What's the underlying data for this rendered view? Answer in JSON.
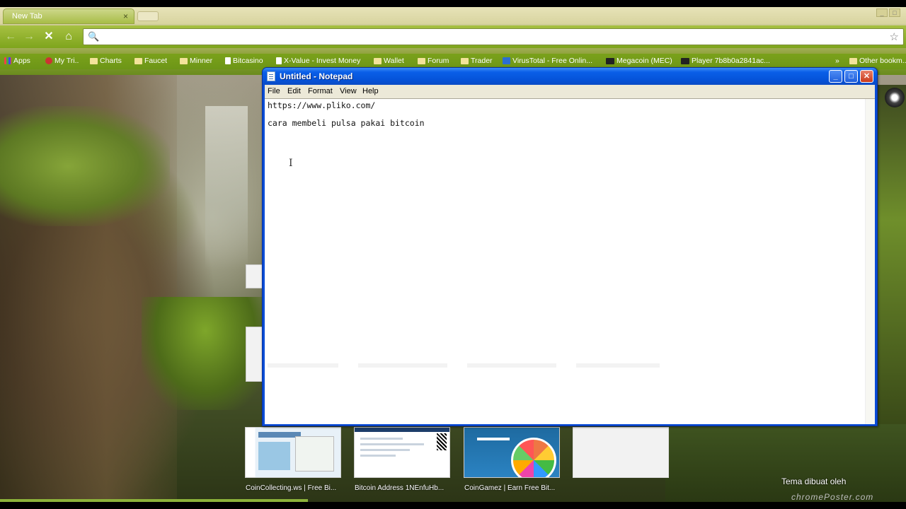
{
  "browser": {
    "tab_title": "New Tab",
    "tab_close": "×",
    "nav": {
      "back": "←",
      "forward": "→",
      "stop": "✕",
      "home": "⌂"
    },
    "omnibox_value": "",
    "icons": {
      "search": "search-icon",
      "star": "star-icon"
    },
    "bookmarks": [
      {
        "label": "Apps",
        "icon": "apps"
      },
      {
        "label": "My Tri..",
        "icon": "red"
      },
      {
        "label": "Charts",
        "icon": "folder"
      },
      {
        "label": "Faucet",
        "icon": "folder"
      },
      {
        "label": "Minner",
        "icon": "folder"
      },
      {
        "label": "Bitcasino",
        "icon": "page"
      },
      {
        "label": "X-Value - Invest Money",
        "icon": "page"
      },
      {
        "label": "Wallet",
        "icon": "folder"
      },
      {
        "label": "Forum",
        "icon": "folder"
      },
      {
        "label": "Trader",
        "icon": "folder"
      },
      {
        "label": "VirusTotal - Free Onlin...",
        "icon": "blue"
      },
      {
        "label": "Megacoin (MEC)",
        "icon": "dark"
      },
      {
        "label": "Player 7b8b0a2841ac...",
        "icon": "dark"
      },
      {
        "label": "Other bookm...",
        "icon": "folder"
      }
    ],
    "bookmarks_overflow": "»"
  },
  "notepad": {
    "title": "Untitled - Notepad",
    "controls": {
      "minimize": "_",
      "maximize": "□",
      "close": "✕"
    },
    "menu": [
      "File",
      "Edit",
      "Format",
      "View",
      "Help"
    ],
    "lines": [
      "https://www.pliko.com/",
      "",
      "cara membeli pulsa pakai bitcoin"
    ],
    "cursor_glyph": "I"
  },
  "most_visited": [
    {
      "title": "CoinCollecting.ws | Free Bi..."
    },
    {
      "title": "Bitcoin Address 1NEnfuHb..."
    },
    {
      "title": "CoinGamez | Earn Free Bit..."
    },
    {
      "title": ""
    }
  ],
  "theme_credit": {
    "line1": "Tema dibuat oleh",
    "line2": "chromePoster.com"
  },
  "colors": {
    "chrome_green": "#7aa11b",
    "xp_blue": "#0553d9",
    "menu_bg": "#ece9d8"
  }
}
